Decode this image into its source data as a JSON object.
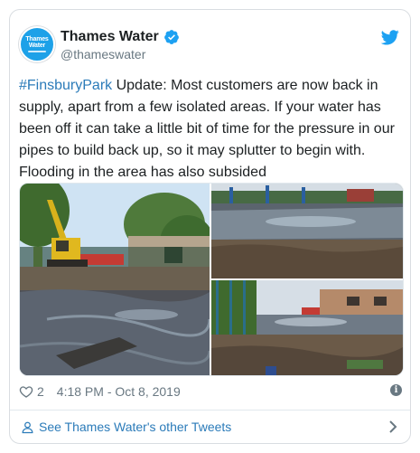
{
  "account": {
    "name": "Thames Water",
    "handle": "@thameswater",
    "avatar_text_line1": "Thames",
    "avatar_text_line2": "Water"
  },
  "tweet": {
    "hashtag": "#FinsburyPark",
    "text": " Update: Most customers are now back in supply, apart from a few isolated areas. If your water has been off it can take a little bit of time for the pressure in our pipes to build back up, so it may splutter to begin with. Flooding in the area has also subsided"
  },
  "media": {
    "photos": [
      "flooded-park-with-excavator",
      "flooded-playground",
      "flooded-street-with-debris"
    ]
  },
  "meta": {
    "likes": "2",
    "timestamp": "4:18 PM - Oct 8, 2019"
  },
  "footer": {
    "link_text": "See Thames Water's other Tweets"
  },
  "colors": {
    "link": "#2b7bb9",
    "twitter_blue": "#1da1f2",
    "text": "#1c2022",
    "muted": "#697882"
  }
}
